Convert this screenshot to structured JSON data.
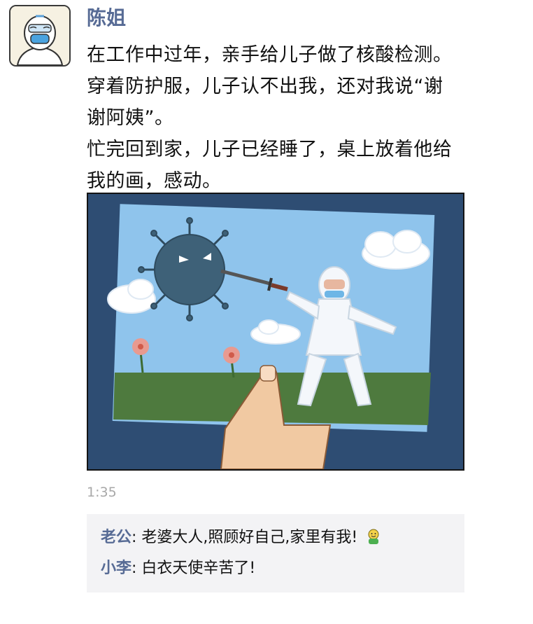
{
  "post": {
    "author": "陈姐",
    "avatar_icon": "hazmat-suit-person-icon",
    "text_lines": [
      "在工作中过年，亲手给儿子做了核酸检测。穿着防护服，儿子认不出我，还对我说“谢谢阿姨”。",
      "忙完回到家，儿子已经睡了，桌上放着他给我的画，感动。"
    ],
    "photo_icon": "child-drawing-hazmat-hero-fighting-virus-icon",
    "time": "1:35"
  },
  "comments": [
    {
      "author": "老公",
      "separator": ": ",
      "text": "老婆大人,照顾好自己,家里有我!",
      "emoji": "cheer-emoji-icon"
    },
    {
      "author": "小李",
      "separator": ": ",
      "text": "白衣天使辛苦了!"
    }
  ],
  "colors": {
    "name_link": "#576b95",
    "comment_bg": "#f3f3f5",
    "time_gray": "#a8a8a8"
  }
}
